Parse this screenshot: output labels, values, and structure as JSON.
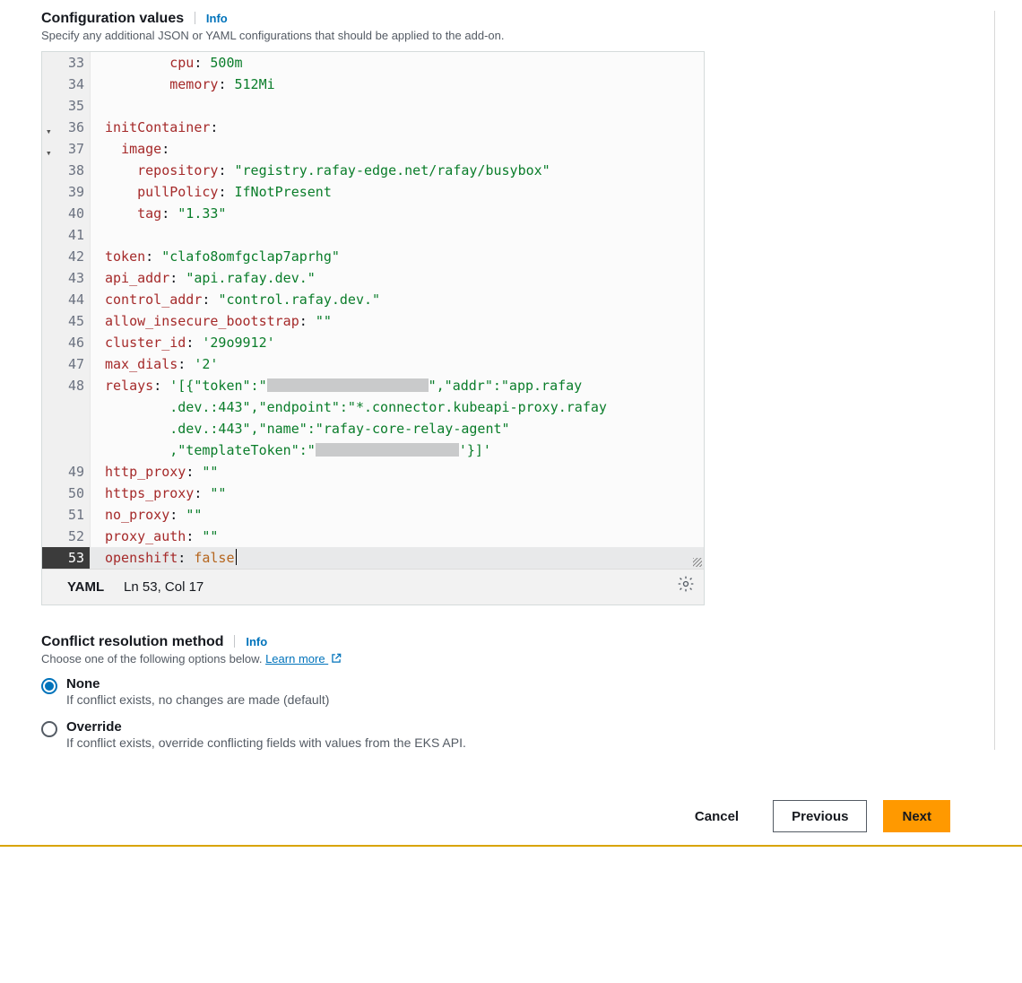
{
  "config": {
    "title": "Configuration values",
    "info": "Info",
    "desc": "Specify any additional JSON or YAML configurations that should be applied to the add-on."
  },
  "editor": {
    "lines": [
      {
        "n": "33",
        "fold": "",
        "seg": [
          {
            "t": "        "
          },
          {
            "t": "cpu",
            "c": "k-key"
          },
          {
            "t": ": "
          },
          {
            "t": "500m",
            "c": "k-str"
          }
        ]
      },
      {
        "n": "34",
        "fold": "",
        "seg": [
          {
            "t": "        "
          },
          {
            "t": "memory",
            "c": "k-key"
          },
          {
            "t": ": "
          },
          {
            "t": "512Mi",
            "c": "k-str"
          }
        ]
      },
      {
        "n": "35",
        "fold": "",
        "seg": [
          {
            "t": ""
          }
        ]
      },
      {
        "n": "36",
        "fold": "▾",
        "seg": [
          {
            "t": "initContainer",
            "c": "k-key"
          },
          {
            "t": ":"
          }
        ]
      },
      {
        "n": "37",
        "fold": "▾",
        "seg": [
          {
            "t": "  "
          },
          {
            "t": "image",
            "c": "k-key"
          },
          {
            "t": ":"
          }
        ]
      },
      {
        "n": "38",
        "fold": "",
        "seg": [
          {
            "t": "    "
          },
          {
            "t": "repository",
            "c": "k-key"
          },
          {
            "t": ": "
          },
          {
            "t": "\"registry.rafay-edge.net/rafay/busybox\"",
            "c": "k-str"
          }
        ]
      },
      {
        "n": "39",
        "fold": "",
        "seg": [
          {
            "t": "    "
          },
          {
            "t": "pullPolicy",
            "c": "k-key"
          },
          {
            "t": ": "
          },
          {
            "t": "IfNotPresent",
            "c": "k-str"
          }
        ]
      },
      {
        "n": "40",
        "fold": "",
        "seg": [
          {
            "t": "    "
          },
          {
            "t": "tag",
            "c": "k-key"
          },
          {
            "t": ": "
          },
          {
            "t": "\"1.33\"",
            "c": "k-str"
          }
        ]
      },
      {
        "n": "41",
        "fold": "",
        "seg": [
          {
            "t": ""
          }
        ]
      },
      {
        "n": "42",
        "fold": "",
        "seg": [
          {
            "t": "token",
            "c": "k-key"
          },
          {
            "t": ": "
          },
          {
            "t": "\"clafo8omfgclap7aprhg\"",
            "c": "k-str"
          }
        ]
      },
      {
        "n": "43",
        "fold": "",
        "seg": [
          {
            "t": "api_addr",
            "c": "k-key"
          },
          {
            "t": ": "
          },
          {
            "t": "\"api.rafay.dev.\"",
            "c": "k-str"
          }
        ]
      },
      {
        "n": "44",
        "fold": "",
        "seg": [
          {
            "t": "control_addr",
            "c": "k-key"
          },
          {
            "t": ": "
          },
          {
            "t": "\"control.rafay.dev.\"",
            "c": "k-str"
          }
        ]
      },
      {
        "n": "45",
        "fold": "",
        "seg": [
          {
            "t": "allow_insecure_bootstrap",
            "c": "k-key"
          },
          {
            "t": ": "
          },
          {
            "t": "\"\"",
            "c": "k-str"
          }
        ]
      },
      {
        "n": "46",
        "fold": "",
        "seg": [
          {
            "t": "cluster_id",
            "c": "k-key"
          },
          {
            "t": ": "
          },
          {
            "t": "'29o9912'",
            "c": "k-str"
          }
        ]
      },
      {
        "n": "47",
        "fold": "",
        "seg": [
          {
            "t": "max_dials",
            "c": "k-key"
          },
          {
            "t": ": "
          },
          {
            "t": "'2'",
            "c": "k-str"
          }
        ]
      },
      {
        "n": "48",
        "fold": "",
        "seg": [
          {
            "t": "relays",
            "c": "k-key"
          },
          {
            "t": ": "
          },
          {
            "t": "'[{\"token\":\"",
            "c": "k-str"
          },
          {
            "redact": "w1"
          },
          {
            "t": "\",\"addr\":\"app.rafay",
            "c": "k-str"
          }
        ],
        "cont": [
          [
            {
              "t": "    .dev.:443\",\"endpoint\":\"*.connector.kubeapi-proxy.rafay",
              "c": "k-str"
            }
          ],
          [
            {
              "t": "    .dev.:443\",\"name\":\"rafay-core-relay-agent\"",
              "c": "k-str"
            }
          ],
          [
            {
              "t": "    ,\"templateToken\":\"",
              "c": "k-str"
            },
            {
              "redact": "w2"
            },
            {
              "t": "'}]'",
              "c": "k-str"
            }
          ]
        ]
      },
      {
        "n": "49",
        "fold": "",
        "seg": [
          {
            "t": "http_proxy",
            "c": "k-key"
          },
          {
            "t": ": "
          },
          {
            "t": "\"\"",
            "c": "k-str"
          }
        ]
      },
      {
        "n": "50",
        "fold": "",
        "seg": [
          {
            "t": "https_proxy",
            "c": "k-key"
          },
          {
            "t": ": "
          },
          {
            "t": "\"\"",
            "c": "k-str"
          }
        ]
      },
      {
        "n": "51",
        "fold": "",
        "seg": [
          {
            "t": "no_proxy",
            "c": "k-key"
          },
          {
            "t": ": "
          },
          {
            "t": "\"\"",
            "c": "k-str"
          }
        ]
      },
      {
        "n": "52",
        "fold": "",
        "seg": [
          {
            "t": "proxy_auth",
            "c": "k-key"
          },
          {
            "t": ": "
          },
          {
            "t": "\"\"",
            "c": "k-str"
          }
        ]
      },
      {
        "n": "53",
        "fold": "",
        "active": true,
        "cursor": true,
        "seg": [
          {
            "t": "openshift",
            "c": "k-key"
          },
          {
            "t": ": "
          },
          {
            "t": "false",
            "c": "k-bool"
          }
        ]
      }
    ],
    "status": {
      "lang": "YAML",
      "pos": "Ln 53, Col 17"
    }
  },
  "conflict": {
    "title": "Conflict resolution method",
    "info": "Info",
    "desc": "Choose one of the following options below.",
    "learn": "Learn more",
    "options": [
      {
        "title": "None",
        "desc": "If conflict exists, no changes are made (default)",
        "selected": true
      },
      {
        "title": "Override",
        "desc": "If conflict exists, override conflicting fields with values from the EKS API.",
        "selected": false
      }
    ]
  },
  "footer": {
    "cancel": "Cancel",
    "prev": "Previous",
    "next": "Next"
  }
}
